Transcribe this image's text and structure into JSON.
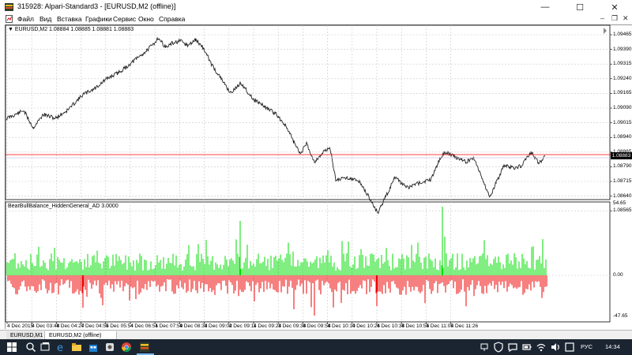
{
  "window": {
    "title": "315928: Alpari-Standard3 - [EURUSD,M2 (offline)]",
    "min_icon": "minimize-icon",
    "max_icon": "maximize-icon",
    "close_icon": "close-icon"
  },
  "menu": {
    "items": [
      "Файл",
      "Вид",
      "Вставка",
      "Графики",
      "Сервис",
      "Окно",
      "Справка"
    ],
    "mdi_controls": [
      "–",
      "❐",
      "✕"
    ]
  },
  "chart": {
    "symbol_label": "EURUSD,M2  1.08884 1.08885 1.08881 1.08883",
    "current_price": "1.08883",
    "price_line_color": "#ff0000",
    "bull_color": "#00dd00",
    "bear_color": "#ee0000",
    "price_levels": [
      "1.09465",
      "1.09390",
      "1.09315",
      "1.09240",
      "1.09165",
      "1.09090",
      "1.09015",
      "1.08940",
      "1.08865",
      "1.08790",
      "1.08715",
      "1.08640",
      "1.08565"
    ],
    "time_labels": [
      "4 Dec 2015",
      "4 Dec 03:48",
      "4 Dec 04:27",
      "4 Dec 04:55",
      "4 Dec 05:54",
      "4 Dec 06:51",
      "4 Dec 07:59",
      "4 Dec 08:33",
      "4 Dec 09:02",
      "4 Dec 09:11",
      "4 Dec 09:23",
      "4 Dec 09:38",
      "4 Dec 09:58",
      "4 Dec 10:10",
      "4 Dec 10:26",
      "4 Dec 10:38",
      "4 Dec 10:55",
      "4 Dec 11:05",
      "4 Dec 11:26"
    ]
  },
  "indicator": {
    "label": "BearBullBalance_HiddenGeneral_AD 3.0000",
    "levels": [
      "54.65",
      "0.00",
      "-47.65"
    ]
  },
  "tabs": [
    "EURUSD,M1",
    "EURUSD,M2 (offline)"
  ],
  "tray": {
    "language": "РУС",
    "time": "14:34"
  },
  "taskbar_icons": [
    "windows-start-icon",
    "task-view-icon",
    "edge-icon",
    "explorer-icon",
    "store-icon",
    "chrome-icon",
    "metatrader-icon"
  ]
}
